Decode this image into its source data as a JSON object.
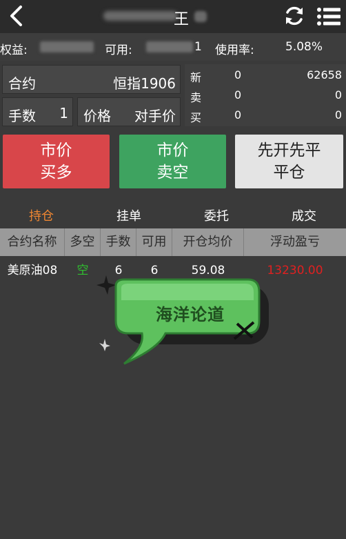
{
  "header": {
    "title_visible": "王",
    "back_icon": "back-arrow-icon",
    "refresh_icon": "refresh-icon",
    "menu_icon": "list-menu-icon"
  },
  "account": {
    "equity_label": "权益:",
    "available_label": "可用:",
    "available_tail": "1",
    "usage_label": "使用率:",
    "usage_value": "5.08%"
  },
  "order": {
    "contract_label": "合约",
    "contract_value": "恒指1906",
    "lots_label": "手数",
    "lots_value": "1",
    "price_label": "价格",
    "price_value": "对手价"
  },
  "quote": {
    "rows": [
      {
        "label": "新",
        "mid": "0",
        "value": "62658"
      },
      {
        "label": "卖",
        "mid": "0",
        "value": "0"
      },
      {
        "label": "买",
        "mid": "0",
        "value": "0"
      }
    ]
  },
  "actions": {
    "buy_line1": "市价",
    "buy_line2": "买多",
    "sell_line1": "市价",
    "sell_line2": "卖空",
    "close_line1": "先开先平",
    "close_line2": "平仓"
  },
  "tabs": [
    "持仓",
    "挂单",
    "委托",
    "成交"
  ],
  "table": {
    "headers": [
      "合约名称",
      "多空",
      "手数",
      "可用",
      "开仓均价",
      "浮动盈亏"
    ],
    "rows": [
      {
        "name": "美原油08",
        "side": "空",
        "lots": "6",
        "available": "6",
        "avg_price": "59.08",
        "pnl": "13230.00"
      }
    ]
  },
  "watermark": {
    "text": "海洋论道"
  },
  "colors": {
    "accent_orange": "#f08732",
    "buy_red": "#d8464a",
    "sell_green": "#3ea360",
    "loss_red": "#e02020",
    "short_green": "#2fc22f"
  }
}
